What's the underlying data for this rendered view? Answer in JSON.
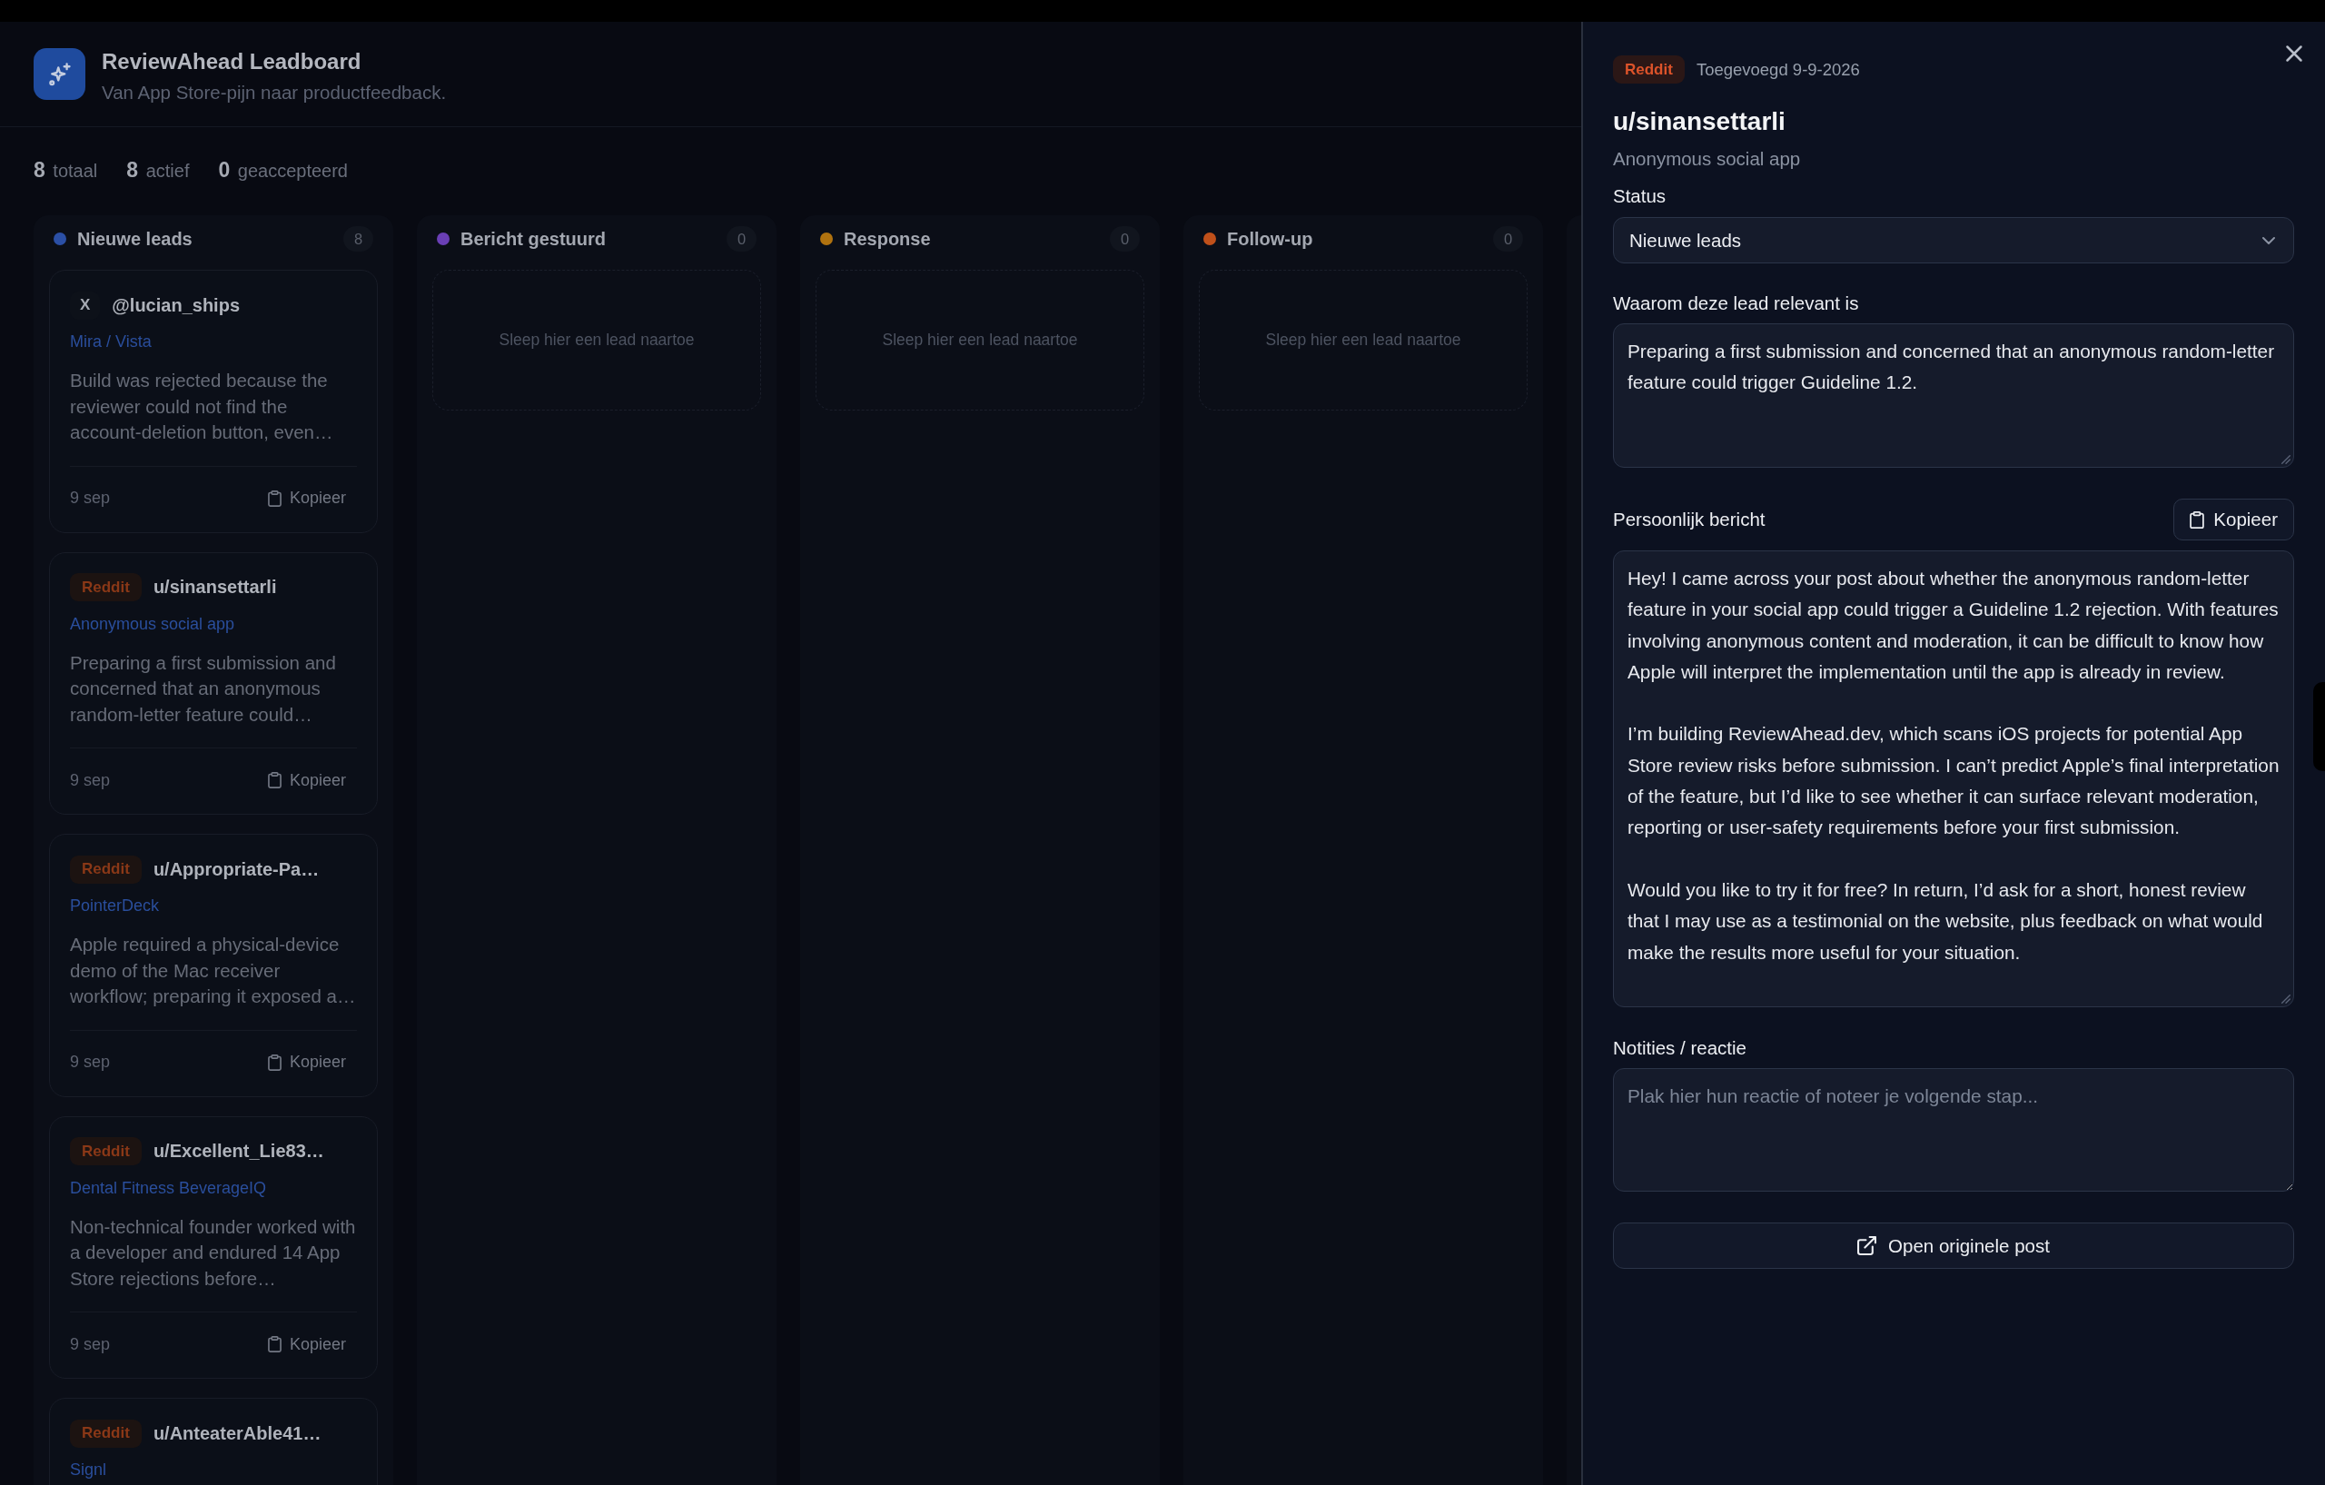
{
  "app": {
    "title": "ReviewAhead Leadboard",
    "subtitle": "Van App Store-pijn naar productfeedback."
  },
  "stats": [
    "**8** totaal",
    "**8** actief",
    "**0** geaccepteerd"
  ],
  "columns": [
    {
      "title": "Nieuwe leads",
      "color": "#2b4fa5",
      "count": "8",
      "cards": [
        {
          "source": {
            "kind": "x",
            "label": "X"
          },
          "handle": "@lucian_ships",
          "project": "Mira / Vista",
          "summary": "Build was rejected because the reviewer could not find the account-deletion button, even…",
          "date": "9 sep",
          "copy_button": "Kopieer"
        },
        {
          "source": {
            "kind": "reddit",
            "label": "Reddit"
          },
          "handle": "u/sinansettarli",
          "project": "Anonymous social app",
          "summary": "Preparing a first submission and concerned that an anonymous random-letter feature could…",
          "date": "9 sep",
          "copy_button": "Kopieer"
        },
        {
          "source": {
            "kind": "reddit",
            "label": "Reddit"
          },
          "handle": "u/Appropriate-Pa…",
          "project": "PointerDeck",
          "summary": "Apple required a physical-device demo of the Mac receiver workflow; preparing it exposed a…",
          "date": "9 sep",
          "copy_button": "Kopieer"
        },
        {
          "source": {
            "kind": "reddit",
            "label": "Reddit"
          },
          "handle": "u/Excellent_Lie83…",
          "project": "Dental Fitness BeverageIQ",
          "summary": "Non-technical founder worked with a developer and endured 14 App Store rejections before…",
          "date": "9 sep",
          "copy_button": "Kopieer"
        },
        {
          "source": {
            "kind": "reddit",
            "label": "Reddit"
          },
          "handle": "u/AnteaterAble41…",
          "project": "Signl"
        }
      ]
    },
    {
      "title": "Bericht gestuurd",
      "color": "#6a3fb5",
      "count": "0",
      "empty_text": "Sleep hier een lead naartoe"
    },
    {
      "title": "Response",
      "color": "#b0720f",
      "count": "0",
      "empty_text": "Sleep hier een lead naartoe"
    },
    {
      "title": "Follow-up",
      "color": "#c0501a",
      "count": "0",
      "empty_text": "Sleep hier een lead naartoe"
    }
  ],
  "detail": {
    "source": {
      "kind": "reddit",
      "label": "Reddit"
    },
    "added": "Toegevoegd 9-9-2026",
    "title": "u/sinansettarli",
    "subtitle": "Anonymous social app",
    "status": {
      "label": "Status",
      "value": "Nieuwe leads"
    },
    "relevance": {
      "label": "Waarom deze lead relevant is",
      "value": "Preparing a first submission and concerned that an anonymous random-letter feature could trigger Guideline 1.2."
    },
    "message": {
      "label": "Persoonlijk bericht",
      "copy_button": "Kopieer",
      "value": "Hey! I came across your post about whether the anonymous random-letter feature in your social app could trigger a Guideline 1.2 rejection. With features involving anonymous content and moderation, it can be difficult to know how Apple will interpret the implementation until the app is already in review.\n\nI’m building ReviewAhead.dev, which scans iOS projects for potential App Store review risks before submission. I can’t predict Apple’s final interpretation of the feature, but I’d like to see whether it can surface relevant moderation, reporting or user-safety requirements before your first submission.\n\nWould you like to try it for free? In return, I’d ask for a short, honest review that I may use as a testimonial on the website, plus feedback on what would make the results more useful for your situation."
    },
    "notes": {
      "label": "Notities / reactie",
      "placeholder": "Plak hier hun reactie of noteer je volgende stap..."
    },
    "open_button": "Open originele post"
  }
}
